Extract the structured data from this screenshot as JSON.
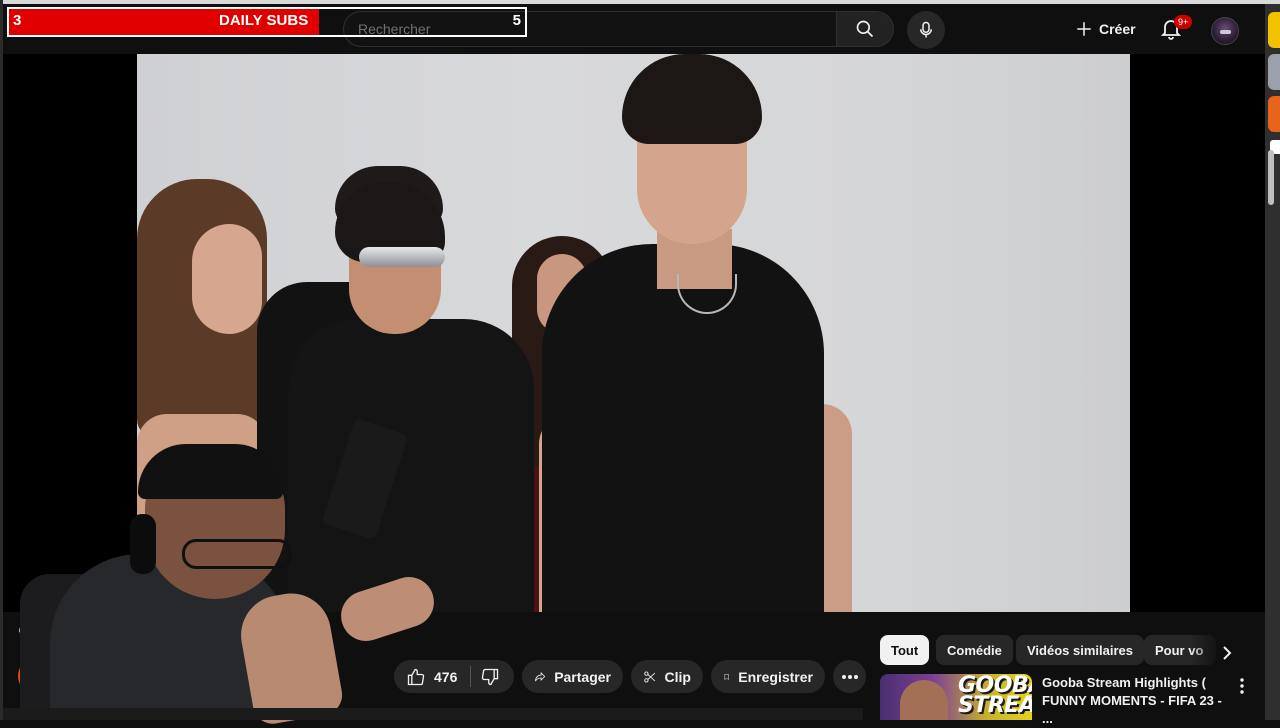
{
  "overlay": {
    "left_value": "3",
    "title": "DAILY SUBS",
    "right_value": "5"
  },
  "header": {
    "search_placeholder": "Rechercher",
    "create_label": "Créer",
    "notification_badge": "9+"
  },
  "video": {
    "title_visible": "“Y",
    "likes": "476"
  },
  "actions": {
    "share_label": "Partager",
    "clip_label": "Clip",
    "save_label": "Enregistrer"
  },
  "chips": {
    "all": "Tout",
    "comedy": "Comédie",
    "similar": "Vidéos similaires",
    "for_you": "Pour vo"
  },
  "recommendation": {
    "title": "Gooba Stream Highlights ( FUNNY MOMENTS - FIFA 23 - ...",
    "thumb_text_line1": "GOOBA",
    "thumb_text_line2": "STREAM"
  },
  "colors": {
    "accent_red": "#e00000",
    "bg": "#0f0f0f",
    "pill": "#272727"
  }
}
